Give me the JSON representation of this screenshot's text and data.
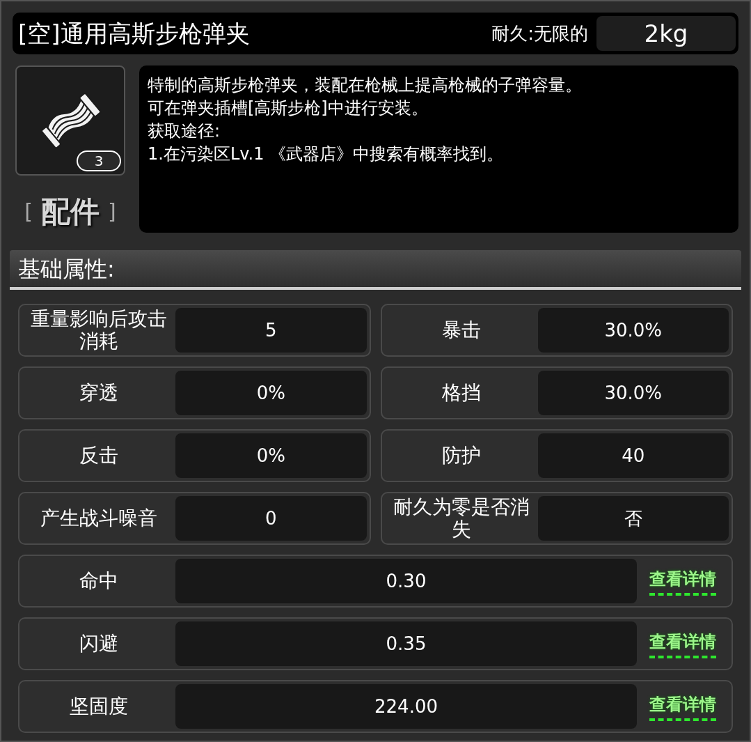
{
  "header": {
    "title": "[空]通用高斯步枪弹夹",
    "durability": "耐久:无限的",
    "weight": "2kg"
  },
  "item": {
    "count": "3",
    "category_open": "[",
    "category": "配件",
    "category_close": "]"
  },
  "description": [
    "特制的高斯步枪弹夹，装配在枪械上提高枪械的子弹容量。",
    "可在弹夹插槽[高斯步枪]中进行安装。",
    "获取途径:",
    "1.在污染区Lv.1 《武器店》中搜索有概率找到。"
  ],
  "section_title": "基础属性:",
  "stats": [
    {
      "label": "重量影响后攻击消耗",
      "value": "5"
    },
    {
      "label": "暴击",
      "value": "30.0%"
    },
    {
      "label": "穿透",
      "value": "0%"
    },
    {
      "label": "格挡",
      "value": "30.0%"
    },
    {
      "label": "反击",
      "value": "0%"
    },
    {
      "label": "防护",
      "value": "40"
    },
    {
      "label": "产生战斗噪音",
      "value": "0"
    },
    {
      "label": "耐久为零是否消失",
      "value": "否"
    }
  ],
  "detail_stats": [
    {
      "label": "命中",
      "value": "0.30",
      "link": "查看详情"
    },
    {
      "label": "闪避",
      "value": "0.35",
      "link": "查看详情"
    },
    {
      "label": "坚固度",
      "value": "224.00",
      "link": "查看详情"
    }
  ]
}
